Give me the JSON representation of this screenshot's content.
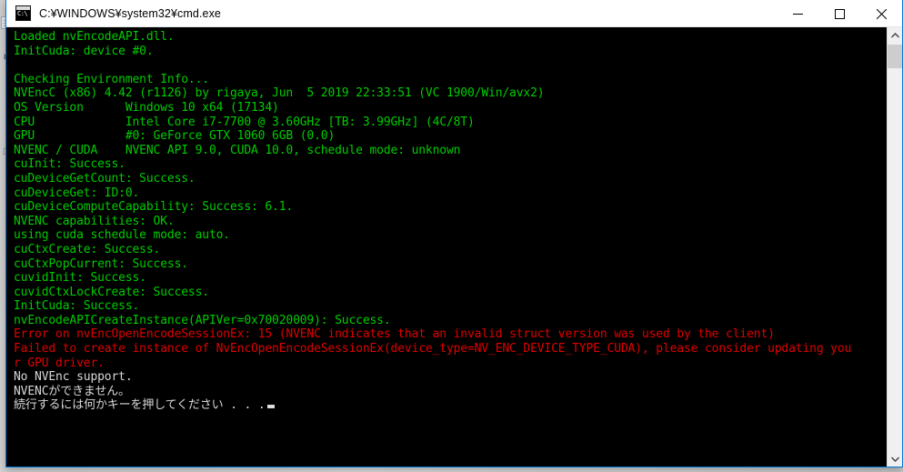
{
  "window": {
    "title": "C:¥WINDOWS¥system32¥cmd.exe",
    "icon": "cmd-console-icon",
    "icon_prompt": "C:\\",
    "accent_color": "#0078d7",
    "titlebar_bg": "#ffffff",
    "controls": {
      "minimize_label": "Minimize",
      "maximize_label": "Maximize",
      "close_label": "Close"
    }
  },
  "console": {
    "background_color": "#000000",
    "text_color": "#00cc00",
    "error_color": "#e00000",
    "prompt_color": "#d8d8d8",
    "lines": [
      {
        "text": "Loaded nvEncodeAPI.dll.",
        "color": "green"
      },
      {
        "text": "InitCuda: device #0.",
        "color": "green"
      },
      {
        "text": "",
        "color": "green"
      },
      {
        "text": "Checking Environment Info...",
        "color": "green"
      },
      {
        "text": "NVEncC (x86) 4.42 (r1126) by rigaya, Jun  5 2019 22:33:51 (VC 1900/Win/avx2)",
        "color": "green"
      },
      {
        "text": "OS Version      Windows 10 x64 (17134)",
        "color": "green"
      },
      {
        "text": "CPU             Intel Core i7-7700 @ 3.60GHz [TB: 3.99GHz] (4C/8T)",
        "color": "green"
      },
      {
        "text": "GPU             #0: GeForce GTX 1060 6GB (0.0)",
        "color": "green"
      },
      {
        "text": "NVENC / CUDA    NVENC API 9.0, CUDA 10.0, schedule mode: unknown",
        "color": "green"
      },
      {
        "text": "cuInit: Success.",
        "color": "green"
      },
      {
        "text": "cuDeviceGetCount: Success.",
        "color": "green"
      },
      {
        "text": "cuDeviceGet: ID:0.",
        "color": "green"
      },
      {
        "text": "cuDeviceComputeCapability: Success: 6.1.",
        "color": "green"
      },
      {
        "text": "NVENC capabilities: OK.",
        "color": "green"
      },
      {
        "text": "using cuda schedule mode: auto.",
        "color": "green"
      },
      {
        "text": "cuCtxCreate: Success.",
        "color": "green"
      },
      {
        "text": "cuCtxPopCurrent: Success.",
        "color": "green"
      },
      {
        "text": "cuvidInit: Success.",
        "color": "green"
      },
      {
        "text": "cuvidCtxLockCreate: Success.",
        "color": "green"
      },
      {
        "text": "InitCuda: Success.",
        "color": "green"
      },
      {
        "text": "nvEncodeAPICreateInstance(APIVer=0x70020009): Success.",
        "color": "green"
      },
      {
        "text": "Error on nvEncOpenEncodeSessionEx: 15 (NVENC indicates that an invalid struct version was used by the client)",
        "color": "red"
      },
      {
        "text": "Failed to create instance of NvEncOpenEncodeSessionEx(device_type=NV_ENC_DEVICE_TYPE_CUDA), please consider updating you",
        "color": "red"
      },
      {
        "text": "r GPU driver.",
        "color": "red"
      },
      {
        "text": "No NVEnc support.",
        "color": "white"
      },
      {
        "text": "NVENCができません。",
        "color": "white"
      },
      {
        "text": "続行するには何かキーを押してください . . .",
        "color": "white",
        "cursor": true
      }
    ]
  },
  "scrollbar": {
    "up_arrow_label": "Scroll up",
    "down_arrow_label": "Scroll down",
    "thumb_label": "Vertical scrollbar thumb"
  },
  "desktop": {
    "icons": [
      {
        "name": "document-icon",
        "glyph": ""
      },
      {
        "name": "folder-icon",
        "glyph": ""
      },
      {
        "name": "text-icon",
        "glyph": ""
      }
    ]
  }
}
